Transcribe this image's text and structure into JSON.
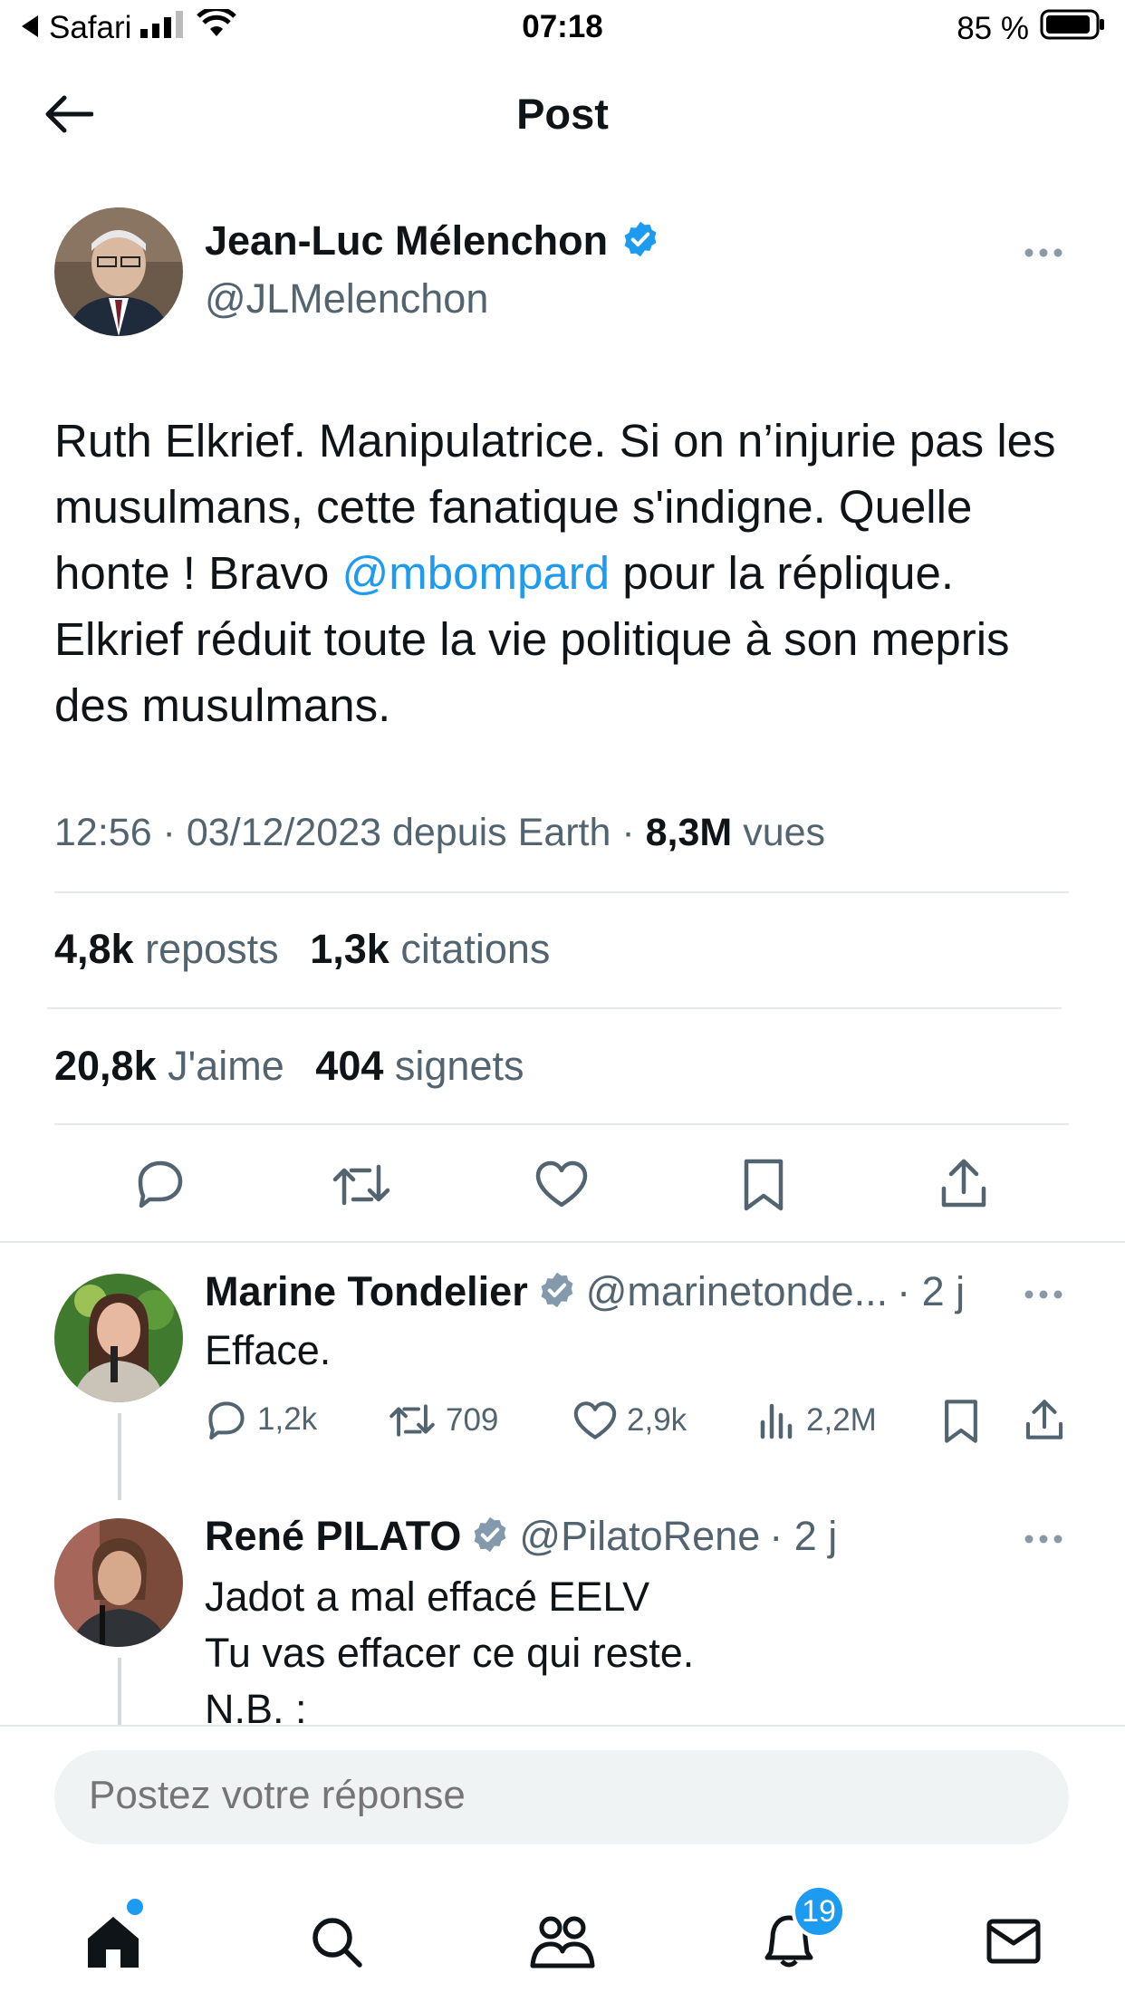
{
  "status_bar": {
    "carrier": "Safari",
    "time": "07:18",
    "battery": "85 %"
  },
  "nav": {
    "title": "Post"
  },
  "tweet": {
    "author_name": "Jean-Luc Mélenchon",
    "author_handle": "@JLMelenchon",
    "text_before_mention": "Ruth Elkrief. Manipulatrice. Si on n’injurie pas les musulmans, cette fanatique s'indigne. Quelle honte ! Bravo ",
    "mention": "@mbompard",
    "text_after_mention": " pour la réplique. Elkrief réduit toute la vie politique à son mepris des musulmans.",
    "timestamp": "12:56 · 03/12/2023 depuis Earth ·",
    "views_count": "8,3M",
    "views_label": "vues",
    "reposts_count": "4,8k",
    "reposts_label": "reposts",
    "quotes_count": "1,3k",
    "quotes_label": "citations",
    "likes_count": "20,8k",
    "likes_label": "J'aime",
    "bookmarks_count": "404",
    "bookmarks_label": "signets"
  },
  "replies": [
    {
      "name": "Marine Tondelier",
      "handle": "@marinetonde...",
      "time": "· 2 j",
      "lines": [
        "Efface."
      ],
      "replies": "1,2k",
      "reposts": "709",
      "likes": "2,9k",
      "views": "2,2M"
    },
    {
      "name": "René PILATO",
      "handle": "@PilatoRene",
      "time": "· 2 j",
      "lines": [
        "Jadot a mal effacé EELV",
        "Tu vas effacer ce qui reste.",
        "N.B.  :"
      ]
    }
  ],
  "compose": {
    "placeholder": "Postez votre réponse"
  },
  "tabbar": {
    "notifications_badge": "19"
  },
  "colors": {
    "accent": "#1d9bf0",
    "text": "#0f1419",
    "secondary": "#536471"
  }
}
